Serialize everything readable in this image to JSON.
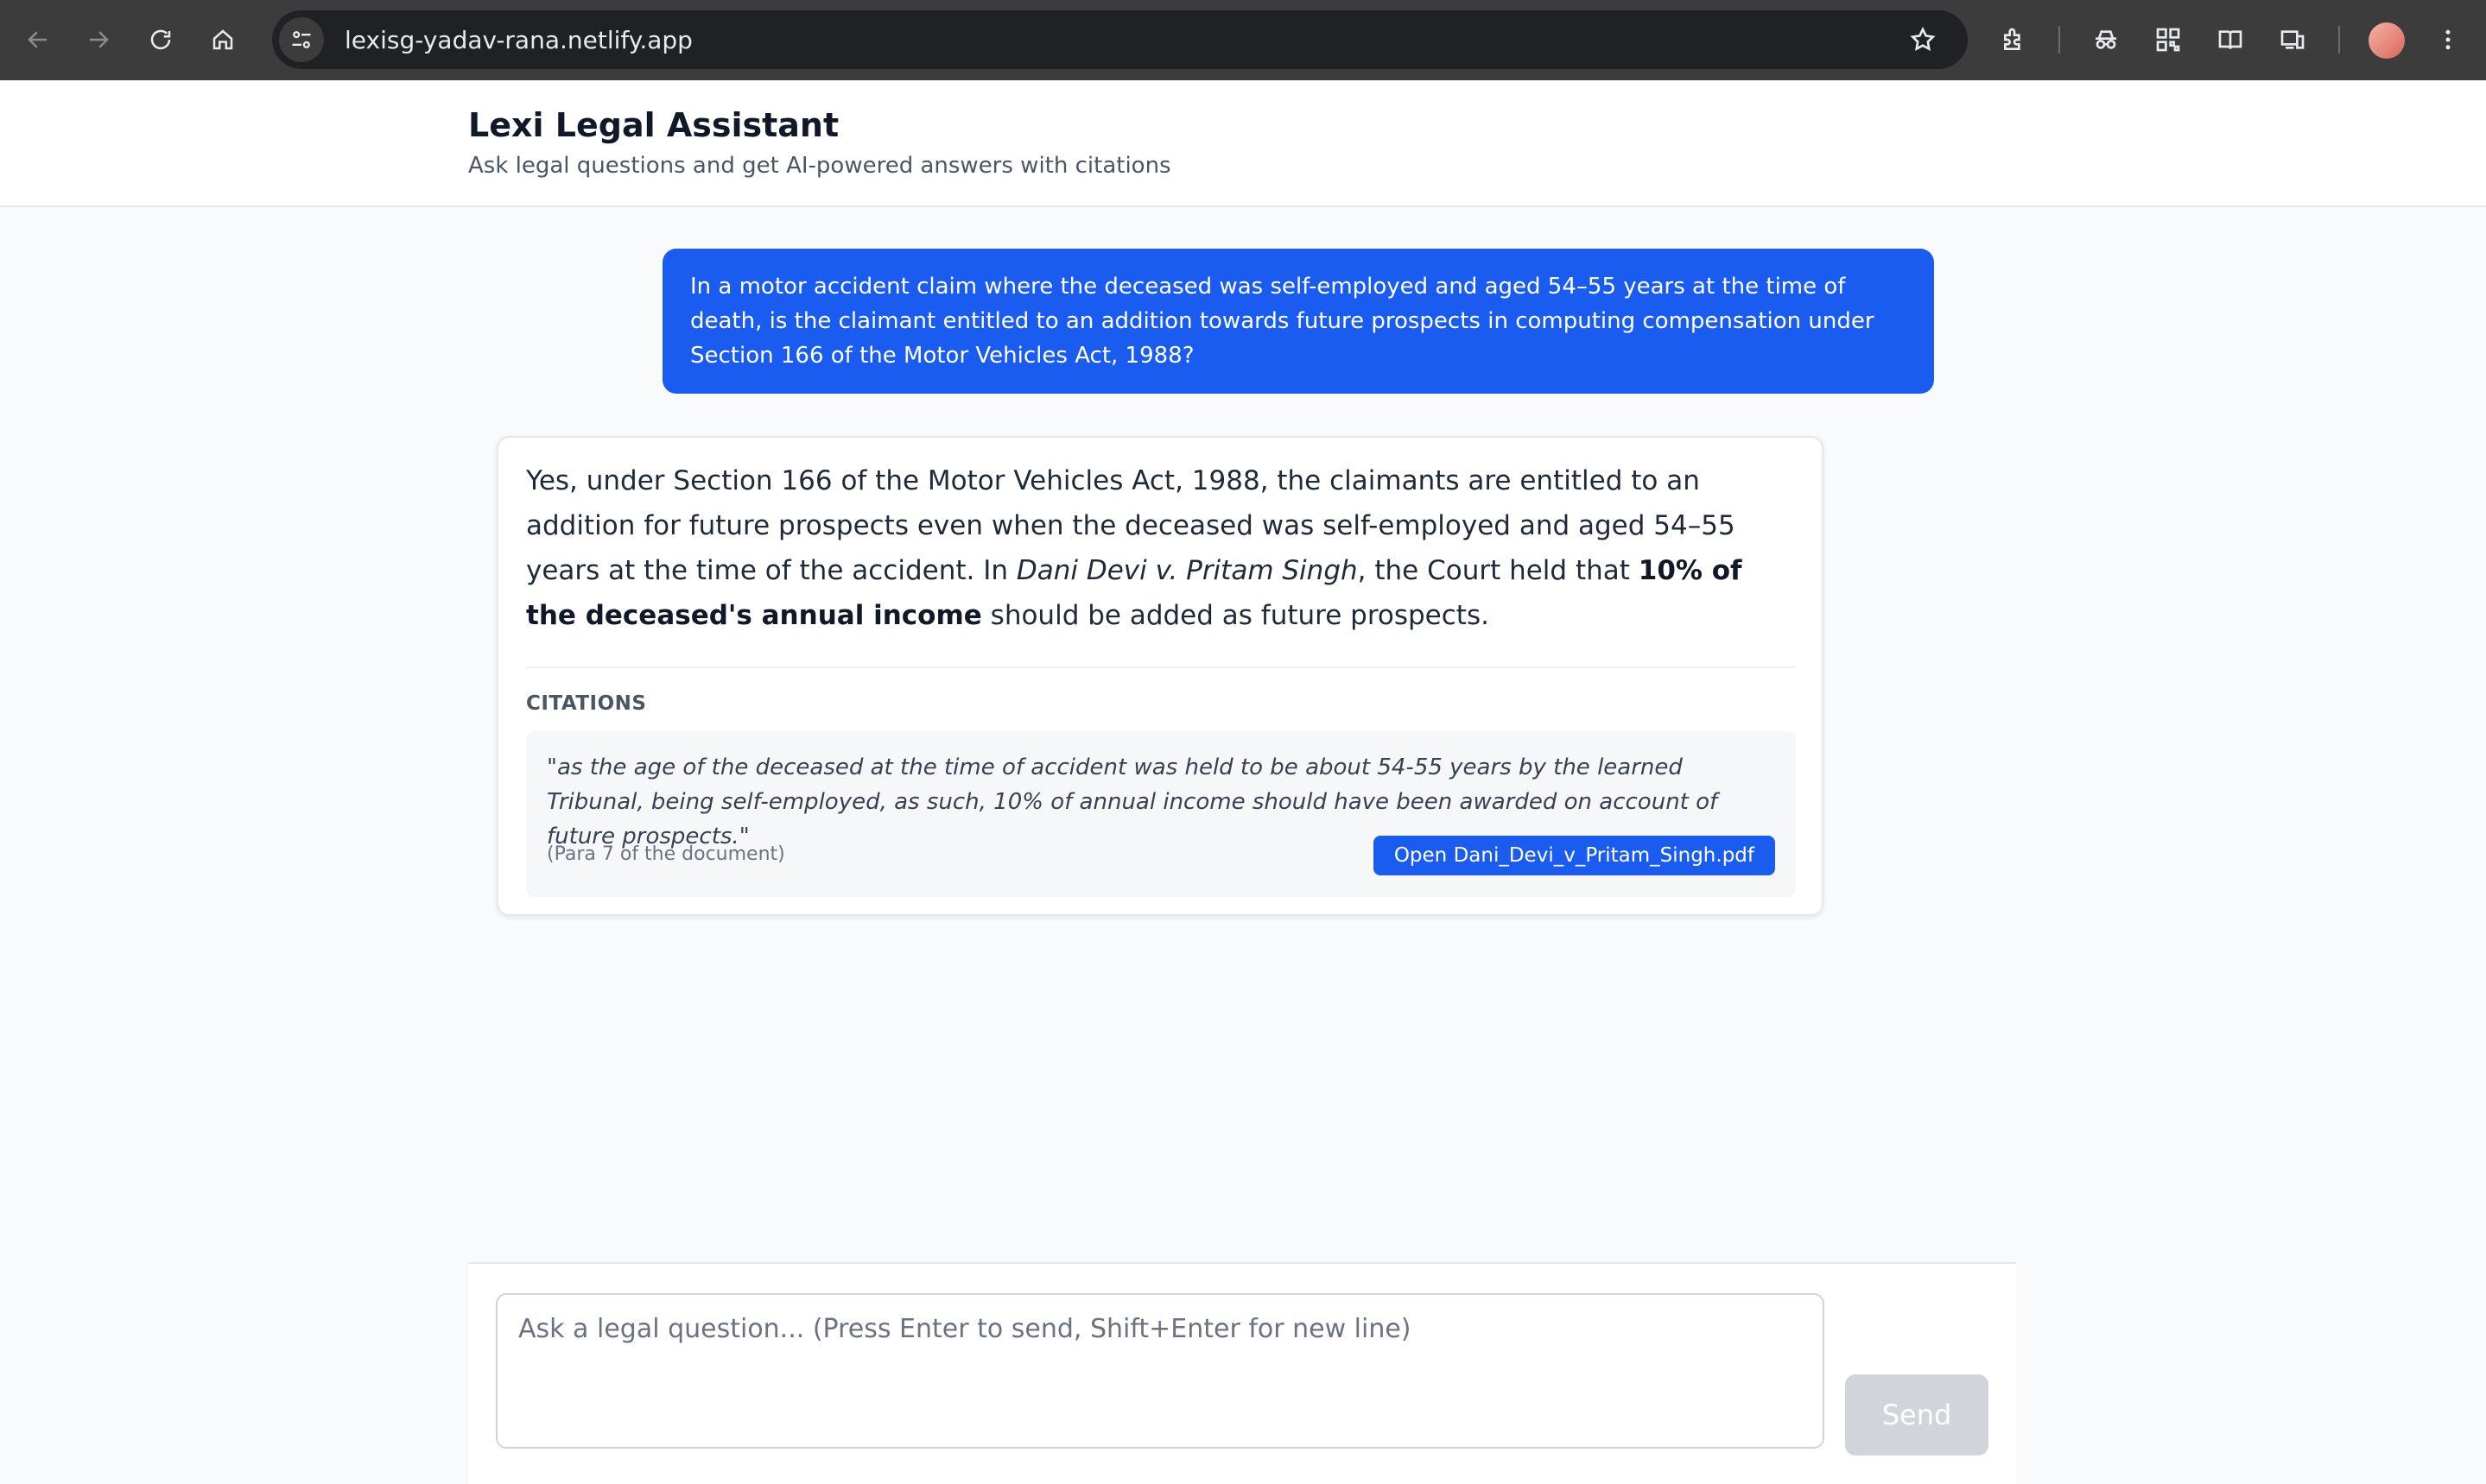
{
  "browser": {
    "url": "lexisg-yadav-rana.netlify.app",
    "icons": [
      "back-icon",
      "forward-icon",
      "reload-icon",
      "home-icon",
      "site-info-icon",
      "bookmark-star-icon",
      "extensions-icon",
      "incognito-icon",
      "qr-code-icon",
      "reading-mode-icon",
      "devices-icon",
      "profile-avatar",
      "menu-icon"
    ]
  },
  "header": {
    "title": "Lexi Legal Assistant",
    "subtitle": "Ask legal questions and get AI-powered answers with citations"
  },
  "conversation": {
    "user_message": "In a motor accident claim where the deceased was self-employed and aged 54–55 years at the time of death, is the claimant entitled to an addition towards future prospects in computing compensation under Section 166 of the Motor Vehicles Act, 1988?",
    "answer": {
      "part1": "Yes, under Section 166 of the Motor Vehicles Act, 1988, the claimants are entitled to an addition for future prospects even when the deceased was self-employed and aged 54–55 years at the time of the accident. In ",
      "case_name": "Dani Devi v. Pritam Singh",
      "part2": ", the Court held that ",
      "bold": "10% of the deceased's annual income",
      "part3": " should be added as future prospects."
    },
    "citations_label": "CITATIONS",
    "citation": {
      "quote": "\"as the age of the deceased at the time of accident was held to be about 54-55 years by the learned Tribunal, being self-employed, as such, 10% of annual income should have been awarded on account of future prospects.\"",
      "para": "(Para 7 of the document)",
      "button_label": "Open Dani_Devi_v_Pritam_Singh.pdf"
    }
  },
  "composer": {
    "placeholder": "Ask a legal question... (Press Enter to send, Shift+Enter for new line)",
    "value": "",
    "send_label": "Send"
  },
  "colors": {
    "accent": "#1a5cf0",
    "send_disabled": "#d1d5db",
    "chrome_bg": "#3c3c3c",
    "omnibox_bg": "#202124"
  }
}
